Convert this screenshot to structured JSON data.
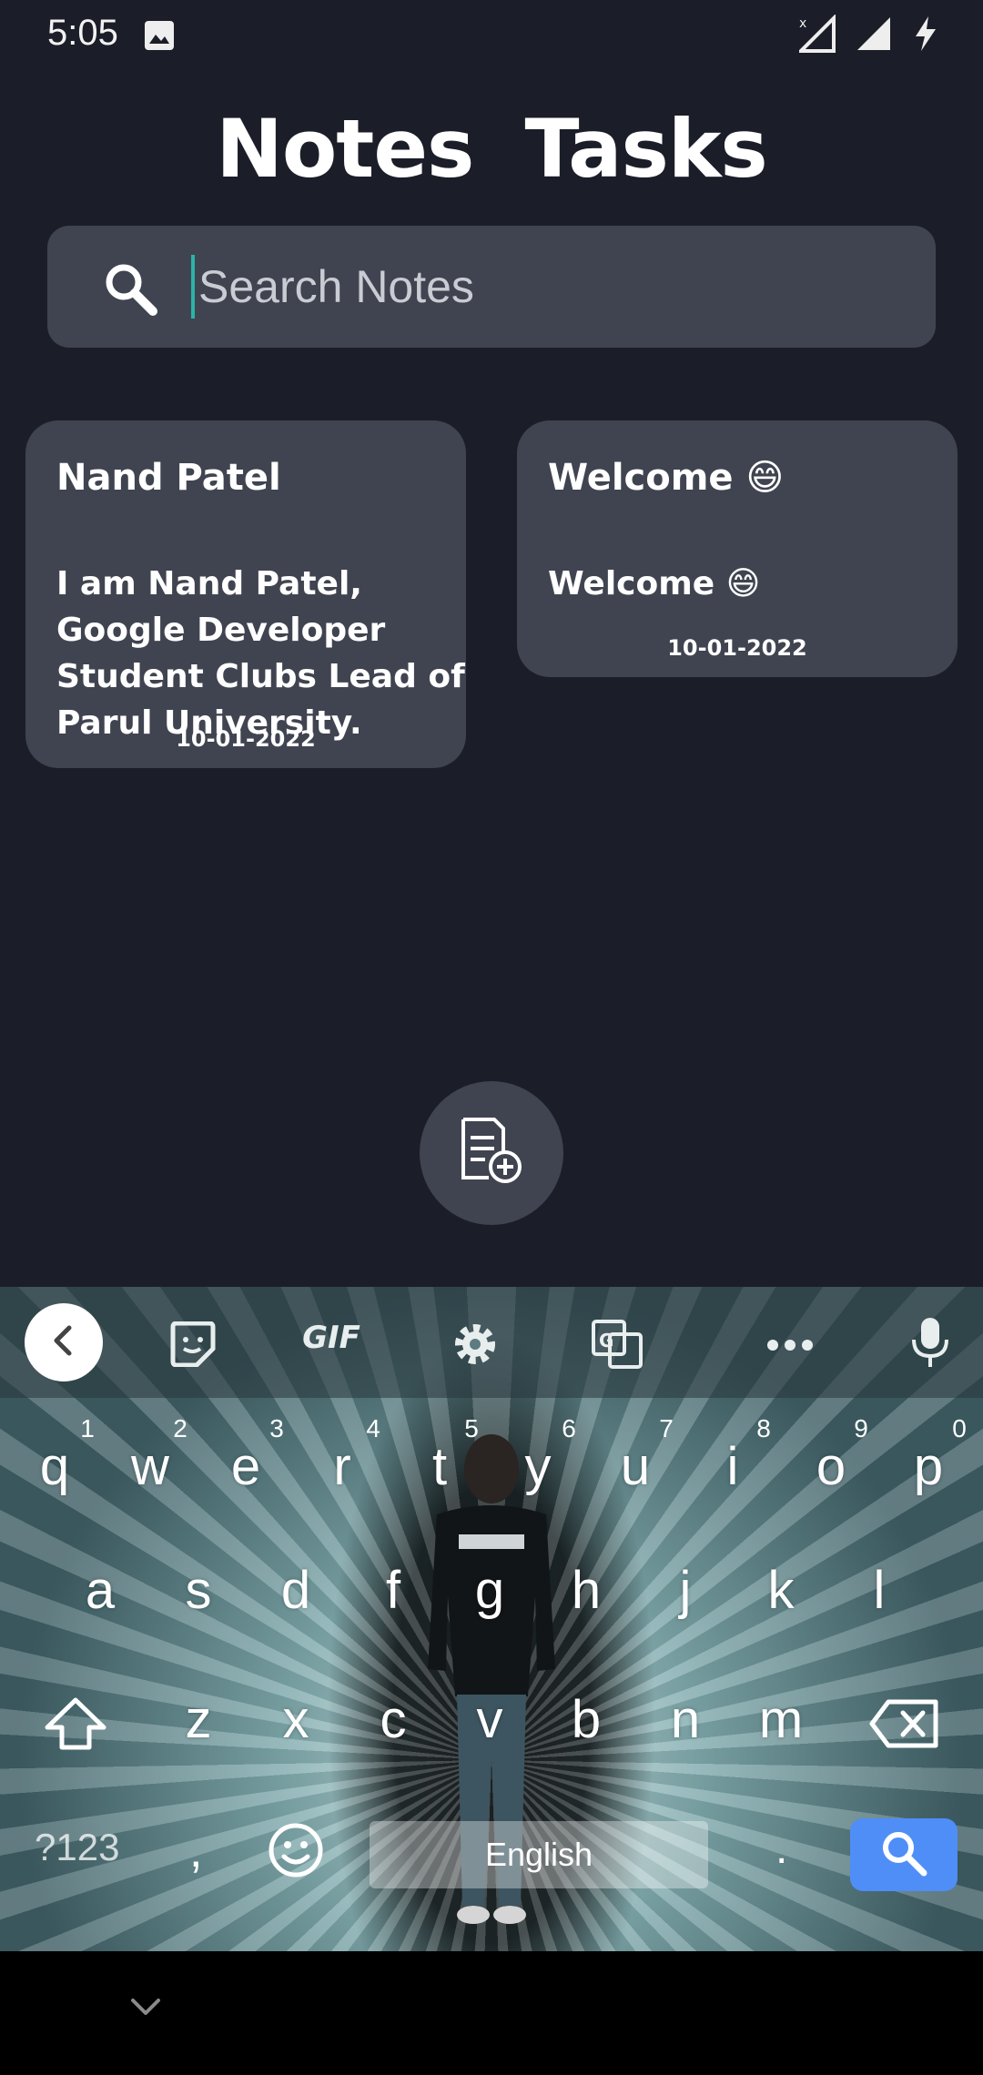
{
  "status_bar": {
    "time": "5:05",
    "icons": [
      "image-icon",
      "signal-x-icon",
      "signal-icon",
      "charging-icon"
    ]
  },
  "header": {
    "tabs": [
      {
        "label": "Notes"
      },
      {
        "label": "Tasks"
      }
    ]
  },
  "search": {
    "placeholder": "Search Notes",
    "value": ""
  },
  "notes": [
    {
      "title": "Nand Patel",
      "body": "I am Nand Patel, Google Developer Student Clubs Lead of Parul University.",
      "date": "10-01-2022"
    },
    {
      "title": "Welcome 😄",
      "body": "Welcome 😄",
      "date": "10-01-2022"
    }
  ],
  "fab": {
    "icon": "add-note-icon"
  },
  "keyboard": {
    "toolbar_icons": [
      "back-icon",
      "sticker-icon",
      "gif-icon",
      "settings-icon",
      "translate-icon",
      "more-icon",
      "mic-icon"
    ],
    "gif_label": "GIF",
    "row1": [
      "q",
      "w",
      "e",
      "r",
      "t",
      "y",
      "u",
      "i",
      "o",
      "p"
    ],
    "row1_hints": [
      "1",
      "2",
      "3",
      "4",
      "5",
      "6",
      "7",
      "8",
      "9",
      "0"
    ],
    "row2": [
      "a",
      "s",
      "d",
      "f",
      "g",
      "h",
      "j",
      "k",
      "l"
    ],
    "row3": [
      "z",
      "x",
      "c",
      "v",
      "b",
      "n",
      "m"
    ],
    "symbols_label": "?123",
    "comma": ",",
    "period": ".",
    "space_label": "English"
  },
  "colors": {
    "background": "#1b1e28",
    "card": "#404450",
    "accent": "#4f8ef7",
    "cursor": "#2bb3a7"
  }
}
